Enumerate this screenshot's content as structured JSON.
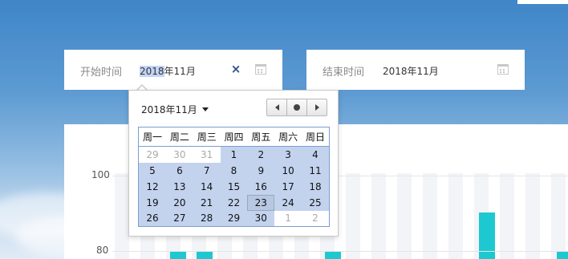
{
  "start_date": {
    "label": "开始时间",
    "value_selected": "2018",
    "value_rest": "年11月"
  },
  "end_date": {
    "label": "结束时间",
    "value": "2018年11月"
  },
  "calendar": {
    "month_label": "2018年11月",
    "weekdays": [
      "周一",
      "周二",
      "周三",
      "周四",
      "周五",
      "周六",
      "周日"
    ],
    "weeks": [
      [
        {
          "d": "29",
          "out": true
        },
        {
          "d": "30",
          "out": true
        },
        {
          "d": "31",
          "out": true
        },
        {
          "d": "1"
        },
        {
          "d": "2"
        },
        {
          "d": "3"
        },
        {
          "d": "4"
        }
      ],
      [
        {
          "d": "5"
        },
        {
          "d": "6"
        },
        {
          "d": "7"
        },
        {
          "d": "8"
        },
        {
          "d": "9"
        },
        {
          "d": "10"
        },
        {
          "d": "11"
        }
      ],
      [
        {
          "d": "12"
        },
        {
          "d": "13"
        },
        {
          "d": "14"
        },
        {
          "d": "15"
        },
        {
          "d": "16"
        },
        {
          "d": "17"
        },
        {
          "d": "18"
        }
      ],
      [
        {
          "d": "19"
        },
        {
          "d": "20"
        },
        {
          "d": "21"
        },
        {
          "d": "22"
        },
        {
          "d": "23",
          "today": true
        },
        {
          "d": "24"
        },
        {
          "d": "25"
        }
      ],
      [
        {
          "d": "26"
        },
        {
          "d": "27"
        },
        {
          "d": "28"
        },
        {
          "d": "29"
        },
        {
          "d": "30"
        },
        {
          "d": "1",
          "out": true
        },
        {
          "d": "2",
          "out": true
        }
      ]
    ]
  },
  "chart_data": {
    "type": "bar",
    "y_ticks": [
      "100",
      "80"
    ],
    "series_color": "#1ec8d0"
  }
}
